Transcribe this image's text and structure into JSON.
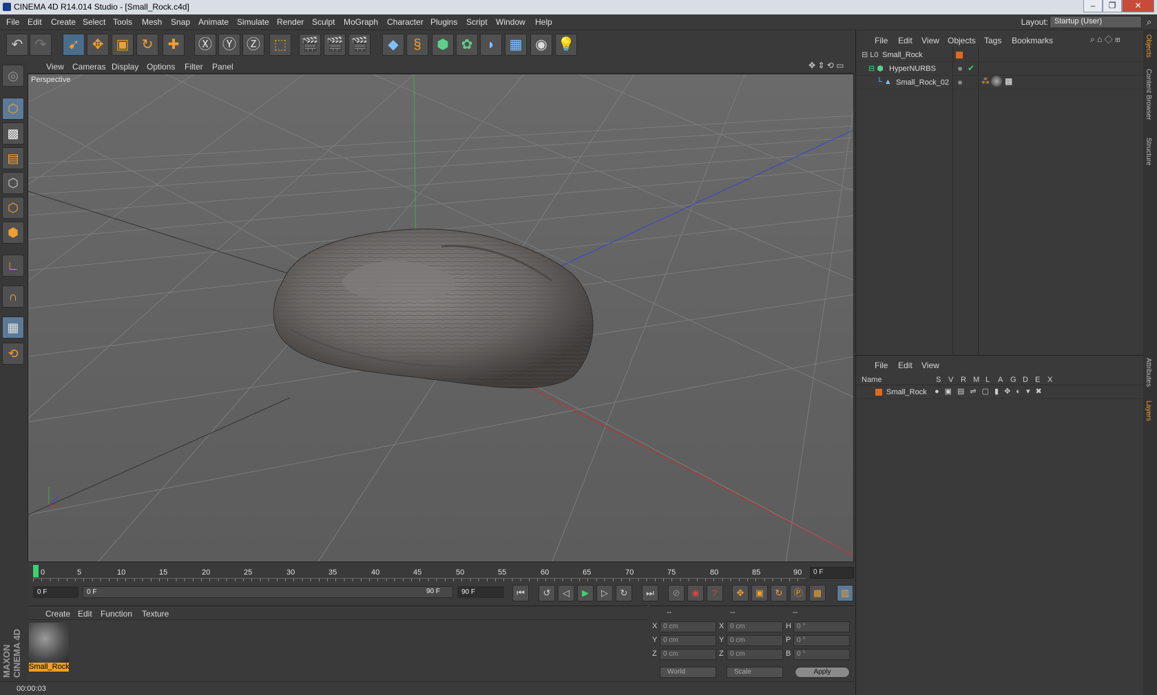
{
  "window": {
    "title": "CINEMA 4D R14.014 Studio - [Small_Rock.c4d]",
    "controls": [
      "–",
      "❐",
      "✕"
    ]
  },
  "menubar": {
    "items": [
      "File",
      "Edit",
      "Create",
      "Select",
      "Tools",
      "Mesh",
      "Snap",
      "Animate",
      "Simulate",
      "Render",
      "Sculpt",
      "MoGraph",
      "Character",
      "Plugins",
      "Script",
      "Window",
      "Help"
    ],
    "layout_label": "Layout:",
    "layout_value": "Startup (User)"
  },
  "viewport": {
    "menu": [
      "View",
      "Cameras",
      "Display",
      "Options",
      "Filter",
      "Panel"
    ],
    "label": "Perspective"
  },
  "timeline": {
    "ticks": [
      "0",
      "5",
      "10",
      "15",
      "20",
      "25",
      "30",
      "35",
      "40",
      "45",
      "50",
      "55",
      "60",
      "65",
      "70",
      "75",
      "80",
      "85",
      "90"
    ],
    "current_frame": "0 F",
    "start": "0 F",
    "range_start": "0 F",
    "range_end": "90 F",
    "end": "90 F"
  },
  "material_manager": {
    "menu": [
      "Create",
      "Edit",
      "Function",
      "Texture"
    ],
    "materials": [
      "Small_Rock"
    ]
  },
  "coordinates": {
    "headers": [
      "--",
      "--",
      "--"
    ],
    "rows": [
      {
        "a": "X",
        "av": "0 cm",
        "b": "X",
        "bv": "0 cm",
        "c": "H",
        "cv": "0 °"
      },
      {
        "a": "Y",
        "av": "0 cm",
        "b": "Y",
        "bv": "0 cm",
        "c": "P",
        "cv": "0 °"
      },
      {
        "a": "Z",
        "av": "0 cm",
        "b": "Z",
        "bv": "0 cm",
        "c": "B",
        "cv": "0 °"
      }
    ],
    "mode": "World",
    "scale": "Scale",
    "apply": "Apply"
  },
  "status": {
    "time": "00:00:03"
  },
  "object_manager": {
    "menu": [
      "File",
      "Edit",
      "View",
      "Objects",
      "Tags",
      "Bookmarks"
    ],
    "objects": [
      "Small_Rock",
      "HyperNURBS",
      "Small_Rock_02"
    ]
  },
  "layer_manager": {
    "menu": [
      "File",
      "Edit",
      "View"
    ],
    "name_header": "Name",
    "columns": [
      "S",
      "V",
      "R",
      "M",
      "L",
      "A",
      "G",
      "D",
      "E",
      "X"
    ],
    "layers": [
      "Small_Rock"
    ]
  },
  "side_tabs": [
    "Objects",
    "Content Browser",
    "Structure",
    "Attributes",
    "Layers"
  ],
  "brand": "MAXON CINEMA 4D"
}
